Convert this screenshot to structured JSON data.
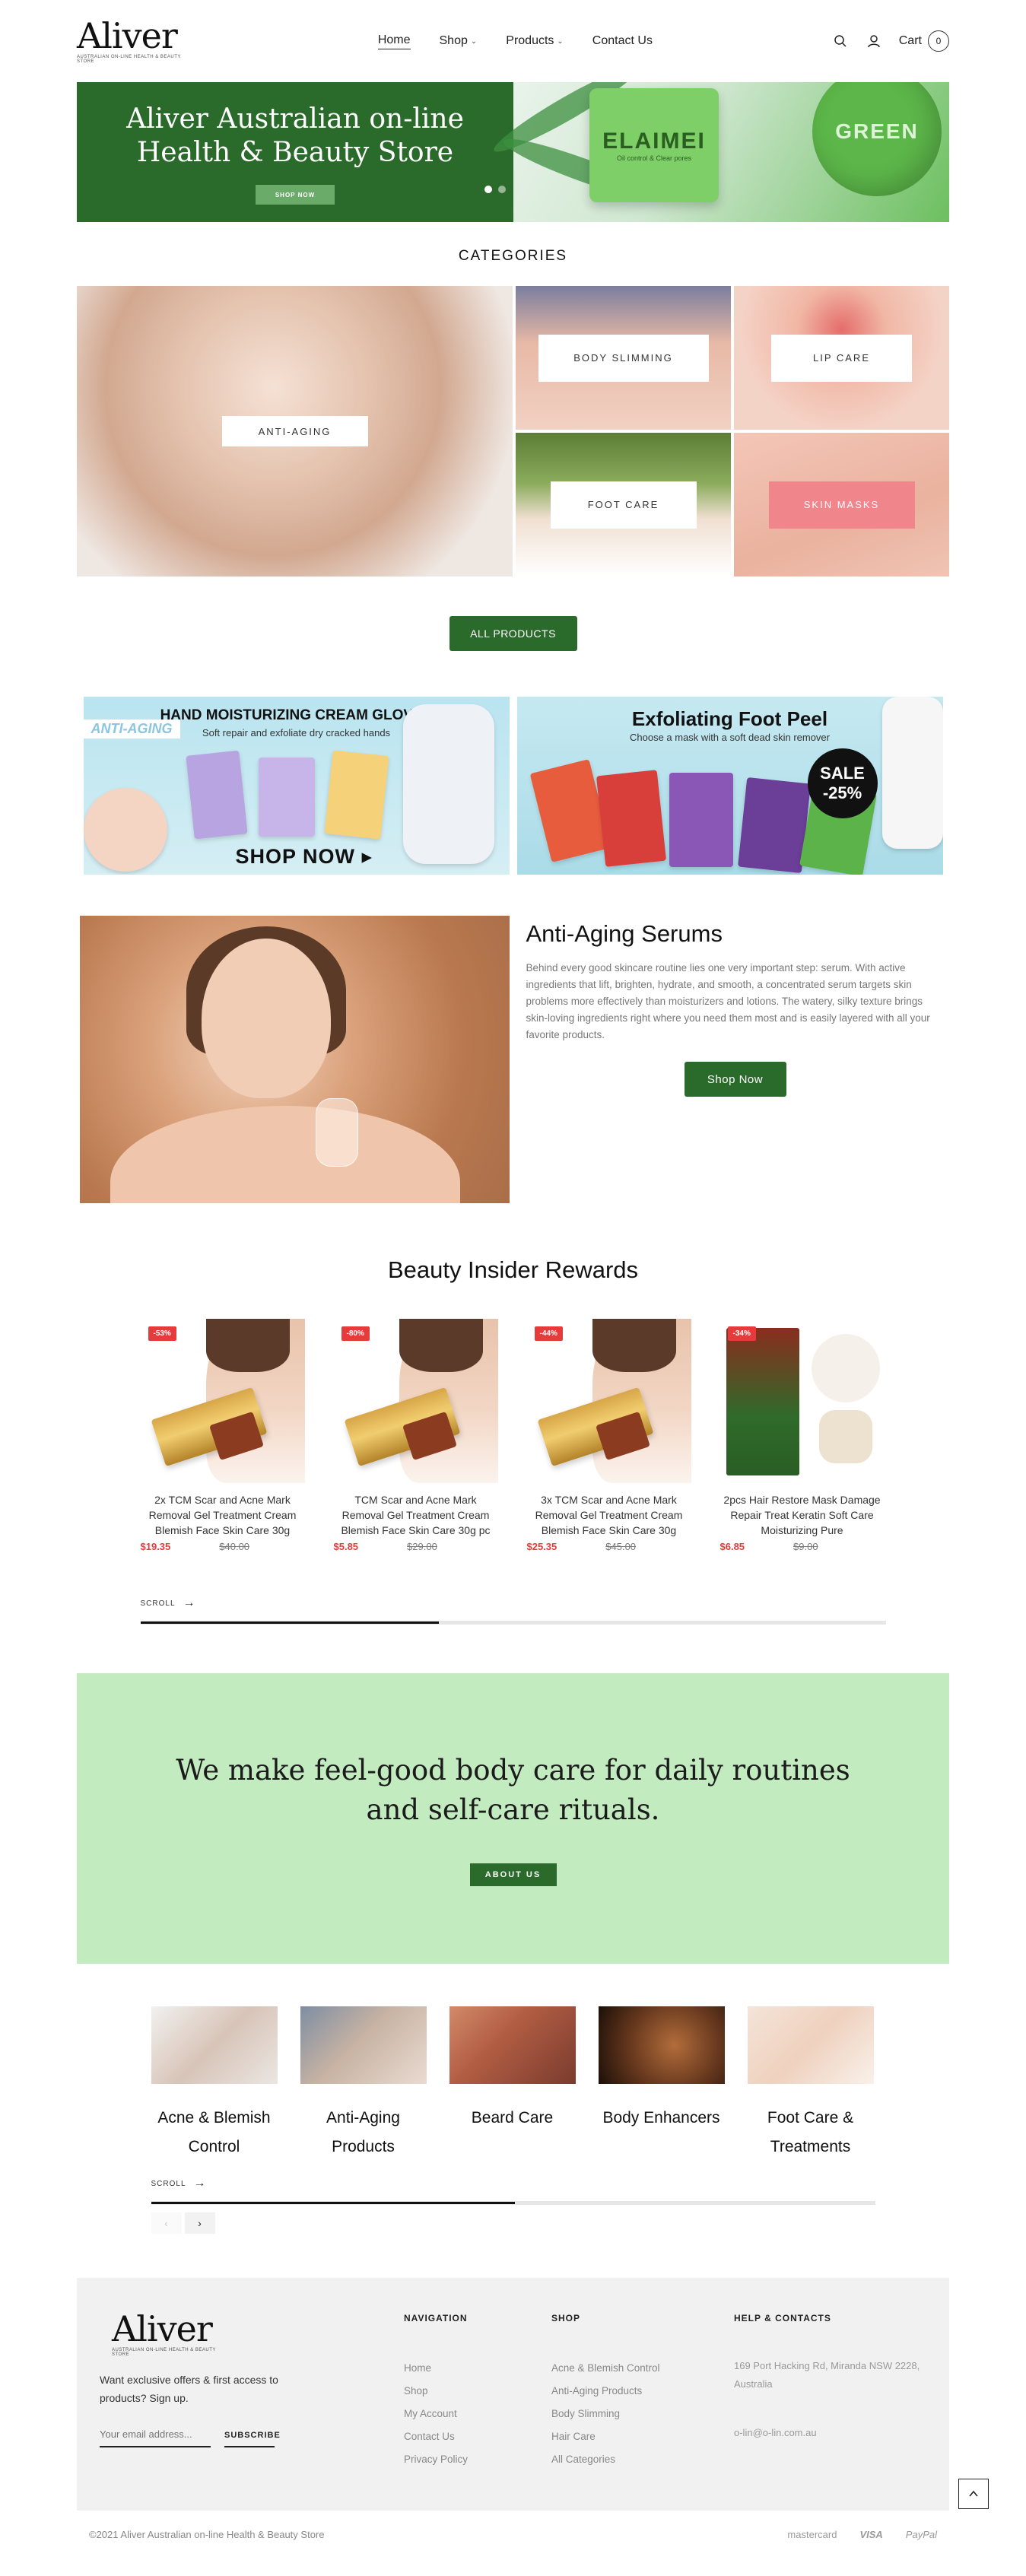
{
  "header": {
    "logo_text": "Aliver",
    "logo_sub": "Australian on-line Health & Beauty Store",
    "nav": [
      {
        "label": "Home"
      },
      {
        "label": "Shop"
      },
      {
        "label": "Products"
      },
      {
        "label": "Contact Us"
      }
    ],
    "cart_label": "Cart",
    "cart_count": "0"
  },
  "hero": {
    "title_line1": "Aliver Australian on-line",
    "title_line2": "Health & Beauty Store",
    "button": "SHOP NOW",
    "product_name": "ELAIMEI",
    "product_sub": "Oil control & Clear pores",
    "jar_text": "GREEN"
  },
  "categories": {
    "title": "CATEGORIES",
    "items": [
      "ANTI-AGING",
      "BODY SLIMMING",
      "LIP CARE",
      "FOOT CARE",
      "SKIN MASKS"
    ],
    "all_button": "ALL PRODUCTS"
  },
  "promos": {
    "a_badge": "ANTI-AGING",
    "a_title": "HAND MOISTURIZING CREAM GLOVES",
    "a_sub": "Soft repair and exfoliate dry cracked hands",
    "a_cta": "SHOP NOW ▸",
    "b_title": "Exfoliating Foot Peel",
    "b_sub": "Choose a mask with a soft dead skin remover",
    "b_sale": "SALE",
    "b_discount": "-25%"
  },
  "feature": {
    "title": "Anti-Aging Serums",
    "body": "Behind every good skincare routine lies one very important step: serum. With active ingredients that lift, brighten, hydrate, and smooth, a concentrated serum targets skin problems more effectively than moisturizers and lotions. The watery, silky texture brings skin-loving ingredients right where you need them most and is easily layered with all your favorite products.",
    "button": "Shop Now"
  },
  "rewards": {
    "title": "Beauty Insider Rewards",
    "products": [
      {
        "discount": "-53%",
        "name": "2x TCM Scar and Acne Mark Removal Gel Treatment Cream Blemish Face Skin Care 30g",
        "price": "$19.35",
        "old_price": "$40.00"
      },
      {
        "discount": "-80%",
        "name": "TCM Scar and Acne Mark Removal Gel Treatment Cream Blemish Face Skin Care 30g pc",
        "price": "$5.85",
        "old_price": "$29.00"
      },
      {
        "discount": "-44%",
        "name": "3x TCM Scar and Acne Mark Removal Gel Treatment Cream Blemish Face Skin Care 30g",
        "price": "$25.35",
        "old_price": "$45.00"
      },
      {
        "discount": "-34%",
        "name": "2pcs Hair Restore Mask Damage Repair Treat Keratin Soft Care Moisturizing Pure",
        "price": "$6.85",
        "old_price": "$9.00"
      }
    ],
    "scroll_label": "SCROLL"
  },
  "feelgood": {
    "line1": "We make feel-good body care for daily routines",
    "line2": "and self-care rituals.",
    "button": "ABOUT US"
  },
  "collections": {
    "items": [
      {
        "line1": "Acne & Blemish",
        "line2": "Control"
      },
      {
        "line1": "Anti-Aging",
        "line2": "Products"
      },
      {
        "line1": "Beard Care",
        "line2": ""
      },
      {
        "line1": "Body Enhancers",
        "line2": ""
      },
      {
        "line1": "Foot Care &",
        "line2": "Treatments"
      }
    ],
    "scroll_label": "SCROLL",
    "prev": "‹",
    "next": "›"
  },
  "footer": {
    "logo_text": "Aliver",
    "logo_sub": "Australian on-line Health & Beauty Store",
    "pitch": "Want exclusive offers & first access to products? Sign up.",
    "email_placeholder": "Your email address...",
    "subscribe": "SUBSCRIBE",
    "nav_head": "NAVIGATION",
    "nav_links": [
      "Home",
      "Shop",
      "My Account",
      "Contact Us",
      "Privacy Policy"
    ],
    "shop_head": "SHOP",
    "shop_links": [
      "Acne & Blemish Control",
      "Anti-Aging Products",
      "Body Slimming",
      "Hair Care",
      "All Categories"
    ],
    "help_head": "HELP & CONTACTS",
    "address": "169 Port Hacking Rd, Miranda NSW 2228, Australia",
    "email": "o-lin@o-lin.com.au",
    "copyright": "©2021 Aliver Australian on-line Health & Beauty Store",
    "payments": [
      "mastercard",
      "VISA",
      "PayPal"
    ]
  },
  "colors": {
    "brand_green": "#2a6b2b",
    "sale_red": "#e53b3b",
    "banner_mint": "#c3ebc0"
  }
}
